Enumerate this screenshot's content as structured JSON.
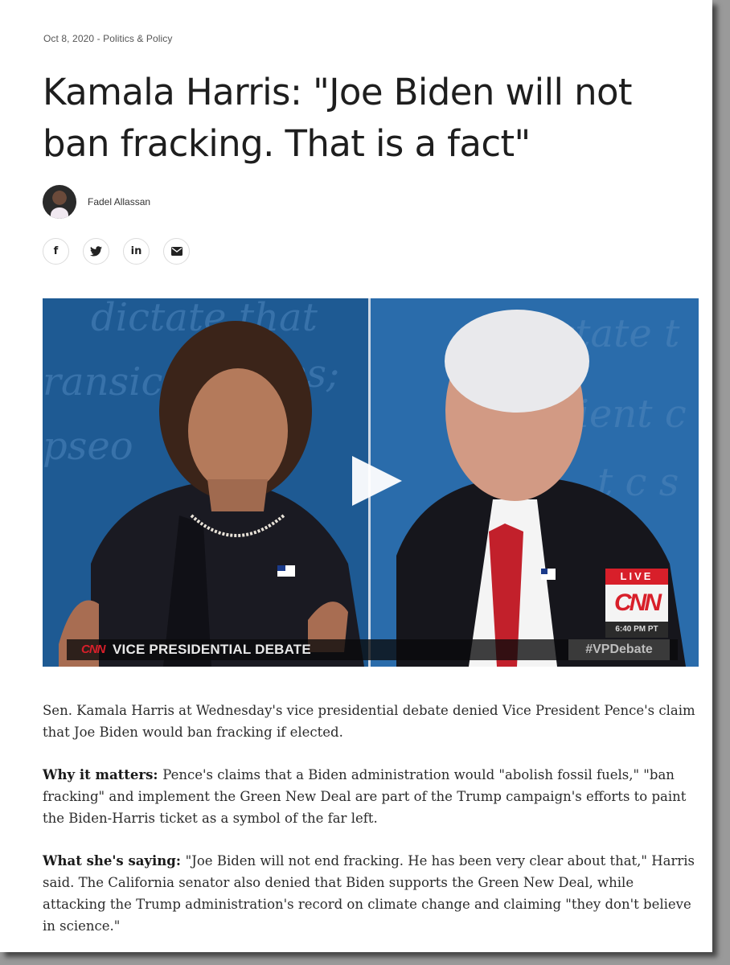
{
  "article": {
    "meta": "Oct 8, 2020 - Politics & Policy",
    "headline": "Kamala Harris: \"Joe Biden will not ban fracking. That is a fact\"",
    "author": "Fadel Allassan"
  },
  "share": [
    {
      "name": "facebook-icon",
      "glyph": "f"
    },
    {
      "name": "twitter-icon",
      "glyph": "🐦"
    },
    {
      "name": "linkedin-icon",
      "glyph": "in"
    },
    {
      "name": "email-icon",
      "glyph": "✉"
    }
  ],
  "video": {
    "chyron_logo": "CNN",
    "chyron_text": "VICE PRESIDENTIAL DEBATE",
    "hashtag": "#VPDebate",
    "live": "LIVE",
    "network": "CNN",
    "time": "6:40 PM PT"
  },
  "body": {
    "p1": "Sen. Kamala Harris at Wednesday's vice presidential debate denied Vice President Pence's claim that Joe Biden would ban fracking if elected.",
    "p2_label": "Why it matters:",
    "p2": "Pence's claims that a Biden administration would \"abolish fossil fuels,\" \"ban fracking\" and implement the Green New Deal are part of the Trump campaign's efforts to paint the Biden-Harris ticket as a symbol of the far left.",
    "p3_label": "What she's saying:",
    "p3": "\"Joe Biden will not end fracking. He has been very clear about that,\" Harris said. The California senator also denied that Biden supports the Green New Deal, while attacking the Trump administration's record on climate change and claiming \"they don't believe in science.\""
  },
  "colors": {
    "video_bg": "#1c4f86",
    "cnn_red": "#d81f2a",
    "text": "#2b2b2b"
  }
}
